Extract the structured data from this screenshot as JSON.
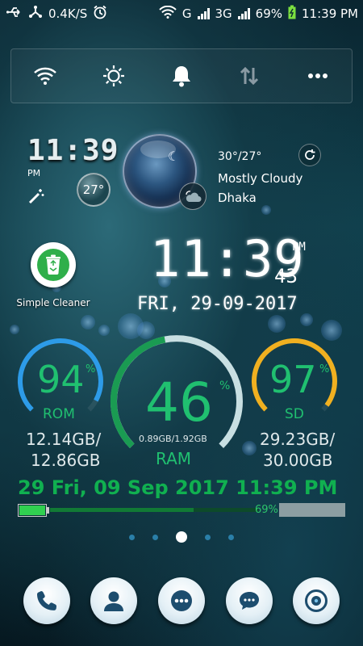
{
  "status_bar": {
    "net_speed": "0.4K/S",
    "network_1": "G",
    "network_2": "3G",
    "battery": "69%",
    "time": "11:39 PM",
    "icons": [
      "usb-icon",
      "share-icon",
      "alarm-icon",
      "wifi-icon",
      "signal-icon",
      "battery-charging-icon"
    ]
  },
  "quick_settings": {
    "icons": [
      "wifi-icon",
      "brightness-icon",
      "bell-icon",
      "data-transfer-icon",
      "more-icon"
    ]
  },
  "weather_widget": {
    "clock": "11:39",
    "ampm": "PM",
    "temp_bubble": "27°",
    "high_low": "30°/27°",
    "condition": "Mostly Cloudy",
    "city": "Dhaka"
  },
  "app_shortcut": {
    "label": "Simple Cleaner",
    "icon": "recycle-bin-icon"
  },
  "digital_clock": {
    "time": "11:39",
    "seconds": "43",
    "ampm": "PM",
    "date": "FRI, 29-09-2017"
  },
  "gauges": {
    "rom": {
      "percent": "94",
      "pct_symbol": "%",
      "label": "ROM",
      "used": "12.14GB/",
      "total": "12.86GB",
      "color": "#2d9be8",
      "fraction": 0.94
    },
    "ram": {
      "percent": "46",
      "pct_symbol": "%",
      "label": "RAM",
      "detail": "0.89GB/1.92GB",
      "color": "#1a9b52",
      "track_color": "#c8dfe2",
      "fraction": 0.46
    },
    "sd": {
      "percent": "97",
      "pct_symbol": "%",
      "label": "SD",
      "used": "29.23GB/",
      "total": "30.00GB",
      "color": "#f0b020",
      "fraction": 0.97
    }
  },
  "long_date": "29 Fri, 09 Sep 2017 11:39 PM",
  "battery_bar": {
    "percent_label": "69%",
    "fraction": 0.69
  },
  "page_indicator": {
    "count": 5,
    "active": 2
  },
  "dock": {
    "icons": [
      "phone-icon",
      "contacts-icon",
      "apps-icon",
      "messages-icon",
      "camera-icon"
    ]
  },
  "colors": {
    "accent_green": "#20c070",
    "date_green": "#10b050"
  }
}
